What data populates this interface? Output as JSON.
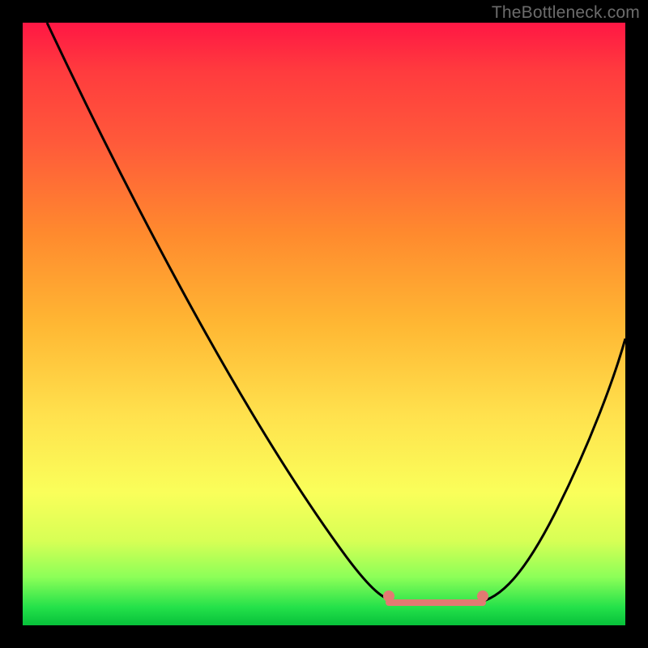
{
  "watermark": "TheBottleneck.com",
  "chart_data": {
    "type": "line",
    "title": "",
    "xlabel": "",
    "ylabel": "",
    "x_range": [
      0,
      100
    ],
    "y_range": [
      0,
      100
    ],
    "background_gradient": {
      "orientation": "vertical",
      "stops": [
        {
          "pct": 0,
          "color": "#ff1744"
        },
        {
          "pct": 20,
          "color": "#ff5a3a"
        },
        {
          "pct": 50,
          "color": "#ffb733"
        },
        {
          "pct": 78,
          "color": "#faff5a"
        },
        {
          "pct": 97,
          "color": "#24e14a"
        },
        {
          "pct": 100,
          "color": "#07c13a"
        }
      ]
    },
    "series": [
      {
        "name": "bottleneck-curve",
        "color": "#000000",
        "x": [
          4,
          10,
          20,
          30,
          40,
          50,
          57,
          60,
          63,
          68,
          74,
          78,
          82,
          88,
          94,
          100
        ],
        "values": [
          100,
          88,
          71,
          54,
          37,
          20,
          8,
          4,
          2,
          1,
          1,
          2,
          5,
          14,
          30,
          48
        ]
      }
    ],
    "flat_valley": {
      "note": "highlighted near-zero segment",
      "x_start": 60,
      "x_end": 78,
      "marker_color": "#e27a72",
      "endpoint_dots": [
        {
          "x": 60,
          "y": 4
        },
        {
          "x": 78,
          "y": 2
        }
      ]
    }
  }
}
